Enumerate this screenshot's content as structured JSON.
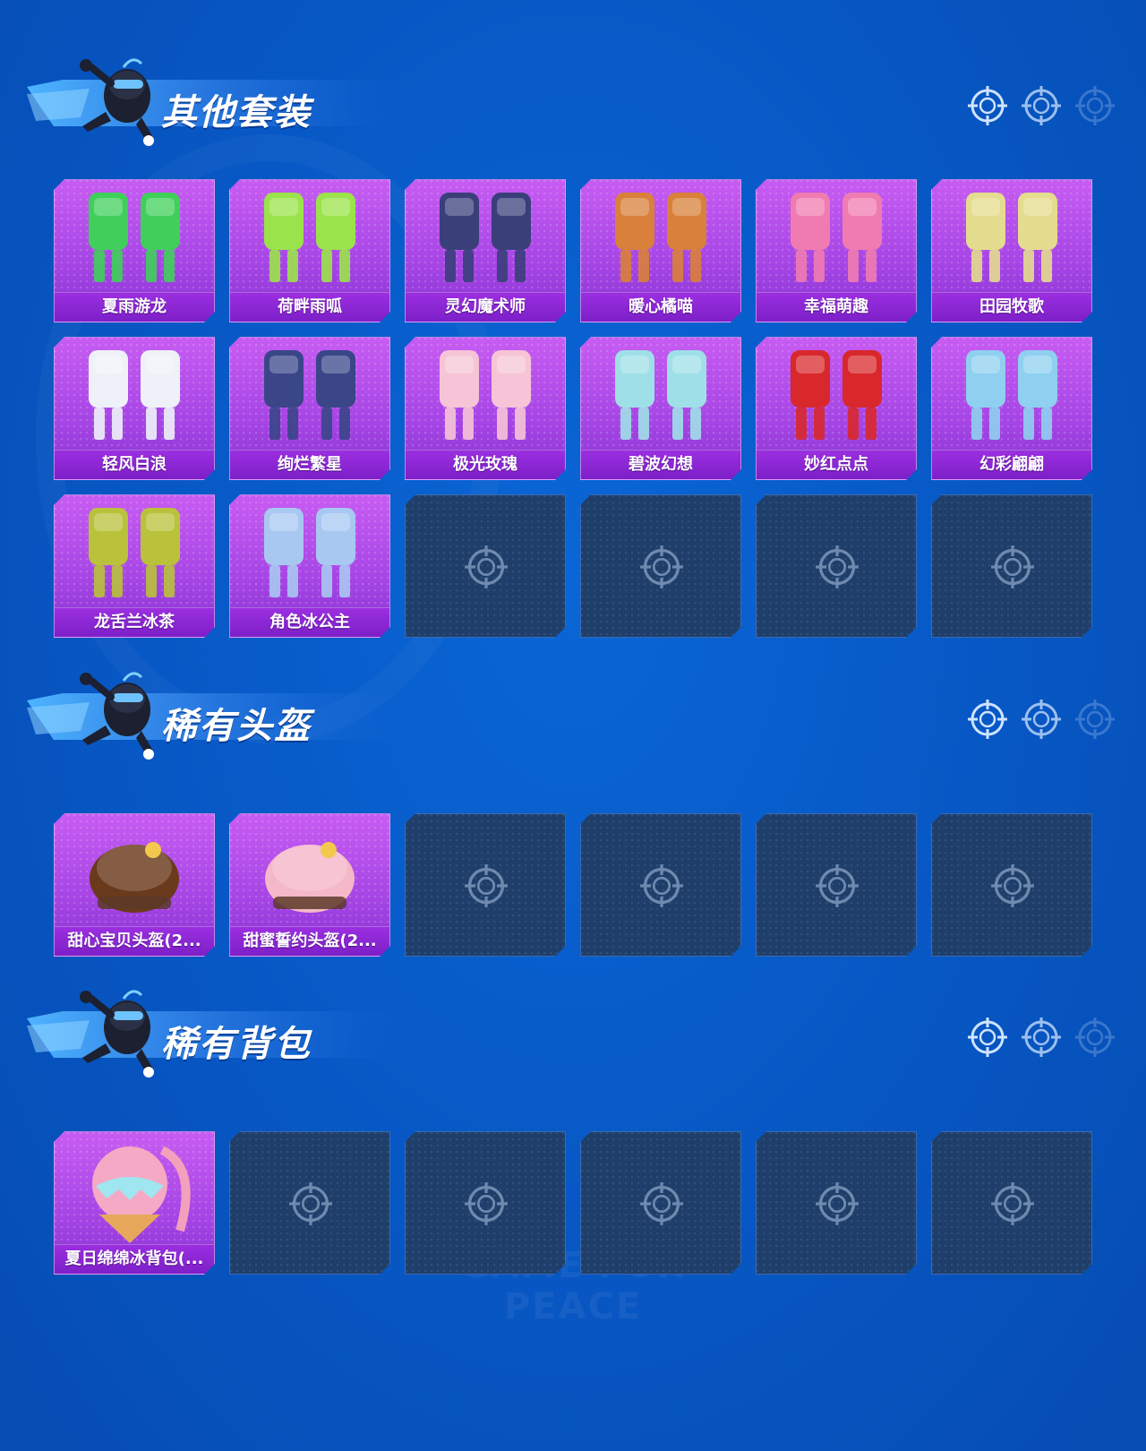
{
  "colors": {
    "background": "#0757c4",
    "card_filled": "#a847e6",
    "card_label_bar": "#7d1fc8",
    "card_empty": "#1f3f6a",
    "title_text": "#ffffff"
  },
  "watermark": "GAME FOR PEACE",
  "sections": [
    {
      "title": "其他套装",
      "items": [
        {
          "name": "夏雨游龙",
          "icon": "green-dragon-outfit-icon",
          "accent": "#3fcf5a"
        },
        {
          "name": "荷畔雨呱",
          "icon": "frog-raincoat-outfit-icon",
          "accent": "#9be34a"
        },
        {
          "name": "灵幻魔术师",
          "icon": "magician-outfit-icon",
          "accent": "#3a3f7a"
        },
        {
          "name": "暖心橘喵",
          "icon": "orange-cat-outfit-icon",
          "accent": "#d9803a"
        },
        {
          "name": "幸福萌趣",
          "icon": "pink-cute-outfit-icon",
          "accent": "#f07bb0"
        },
        {
          "name": "田园牧歌",
          "icon": "pastoral-outfit-icon",
          "accent": "#e4dc8e"
        },
        {
          "name": "轻风白浪",
          "icon": "white-wave-outfit-icon",
          "accent": "#eef2f8"
        },
        {
          "name": "绚烂繁星",
          "icon": "starry-outfit-icon",
          "accent": "#3a4688"
        },
        {
          "name": "极光玫瑰",
          "icon": "aurora-rose-outfit-icon",
          "accent": "#f6c4d6"
        },
        {
          "name": "碧波幻想",
          "icon": "blue-wave-outfit-icon",
          "accent": "#9fe0e8"
        },
        {
          "name": "妙红点点",
          "icon": "red-dots-outfit-icon",
          "accent": "#d8282c"
        },
        {
          "name": "幻彩翩翩",
          "icon": "colorful-outfit-icon",
          "accent": "#8fd0f0"
        },
        {
          "name": "龙舌兰冰茶",
          "icon": "tequila-tea-outfit-icon",
          "accent": "#b9c23a"
        },
        {
          "name": "角色冰公主",
          "icon": "ice-princess-outfit-icon",
          "accent": "#a8c8f2"
        }
      ],
      "empty_slots": 4
    },
    {
      "title": "稀有头盔",
      "items": [
        {
          "name": "甜心宝贝头盔(2...",
          "icon": "chocolate-helmet-icon",
          "accent": "#6a3a1c"
        },
        {
          "name": "甜蜜誓约头盔(2...",
          "icon": "pink-helmet-icon",
          "accent": "#f4b8c8"
        }
      ],
      "empty_slots": 4
    },
    {
      "title": "稀有背包",
      "items": [
        {
          "name": "夏日绵绵冰背包(...",
          "icon": "ice-cream-backpack-icon",
          "accent": "#f6a9c4"
        }
      ],
      "empty_slots": 5
    }
  ]
}
